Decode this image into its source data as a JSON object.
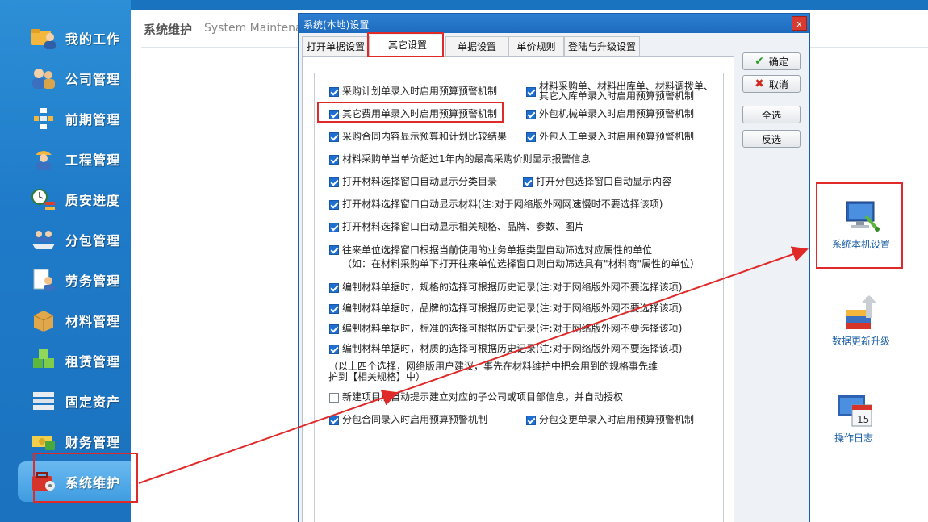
{
  "sidebar": {
    "items": [
      {
        "label": "我的工作",
        "icon": "folder-user-icon"
      },
      {
        "label": "公司管理",
        "icon": "users-key-icon"
      },
      {
        "label": "前期管理",
        "icon": "flowchart-icon"
      },
      {
        "label": "工程管理",
        "icon": "worker-icon"
      },
      {
        "label": "质安进度",
        "icon": "clock-progress-icon"
      },
      {
        "label": "分包管理",
        "icon": "boat-people-icon"
      },
      {
        "label": "劳务管理",
        "icon": "document-person-icon"
      },
      {
        "label": "材料管理",
        "icon": "box-icon"
      },
      {
        "label": "租赁管理",
        "icon": "cubes-icon"
      },
      {
        "label": "固定资产",
        "icon": "server-icon"
      },
      {
        "label": "财务管理",
        "icon": "money-icon"
      },
      {
        "label": "系统维护",
        "icon": "toolbox-icon"
      }
    ],
    "active_index": 11
  },
  "header": {
    "title": "系统维护",
    "subtitle": "System Maintenance"
  },
  "tools": [
    {
      "label": "系统本机设置",
      "icon": "computer-settings-icon"
    },
    {
      "label": "数据更新升级",
      "icon": "database-upgrade-icon"
    },
    {
      "label": "操作日志",
      "icon": "calendar-log-icon"
    }
  ],
  "dialog": {
    "title": "系统(本地)设置",
    "close": "x",
    "tabs": [
      "打开单据设置",
      "其它设置",
      "单据设置",
      "单价规则",
      "登陆与升级设置"
    ],
    "selected_tab": 1,
    "buttons": {
      "ok": "确定",
      "cancel": "取消",
      "select_all": "全选",
      "invert": "反选"
    },
    "options": [
      {
        "text": "采购计划单录入时启用预算预警机制",
        "checked": true
      },
      {
        "text": "材料采购单、材料出库单、材料调拨单、\n其它入库单录入时启用预算预警机制",
        "checked": true
      },
      {
        "text": "其它费用单录入时启用预算预警机制",
        "checked": true
      },
      {
        "text": "外包机械单录入时启用预算预警机制",
        "checked": true
      },
      {
        "text": "采购合同内容显示预算和计划比较结果",
        "checked": true
      },
      {
        "text": "外包人工单录入时启用预算预警机制",
        "checked": true
      },
      {
        "text": "材料采购单当单价超过1年内的最高采购价则显示报警信息",
        "checked": true
      },
      {
        "text": "打开材料选择窗口自动显示分类目录",
        "checked": true
      },
      {
        "text": "打开分包选择窗口自动显示内容",
        "checked": true
      },
      {
        "text": "打开材料选择窗口自动显示材料(注:对于网络版外网网速慢时不要选择该项)",
        "checked": true
      },
      {
        "text": "打开材料选择窗口自动显示相关规格、品牌、参数、图片",
        "checked": true
      },
      {
        "text": "往来单位选择窗口根据当前使用的业务单据类型自动筛选对应属性的单位\n（如：在材料采购单下打开往来单位选择窗口则自动筛选具有\"材料商\"属性的单位）",
        "checked": true
      },
      {
        "text": "编制材料单据时，规格的选择可根据历史记录(注:对于网络版外网不要选择该项)",
        "checked": true
      },
      {
        "text": "编制材料单据时，品牌的选择可根据历史记录(注:对于网络版外网不要选择该项)",
        "checked": true
      },
      {
        "text": "编制材料单据时，标准的选择可根据历史记录(注:对于网络版外网不要选择该项)",
        "checked": true
      },
      {
        "text": "编制材料单据时，材质的选择可根据历史记录(注:对于网络版外网不要选择该项)",
        "checked": true
      },
      {
        "text": "新建项目后自动提示建立对应的子公司或项目部信息，并自动授权",
        "checked": false
      },
      {
        "text": "分包合同录入时启用预算预警机制",
        "checked": true
      },
      {
        "text": "分包变更单录入时启用预算预警机制",
        "checked": true
      }
    ],
    "note_line1": "（以上四个选择，网络版用户建议，事先在材料维护中把会用到的规格事先维",
    "note_line2": "护到【相关规格】中）"
  },
  "colors": {
    "sidebar": "#1f7bc9",
    "accent": "#1e6fd0",
    "highlight": "#e02a2a"
  }
}
